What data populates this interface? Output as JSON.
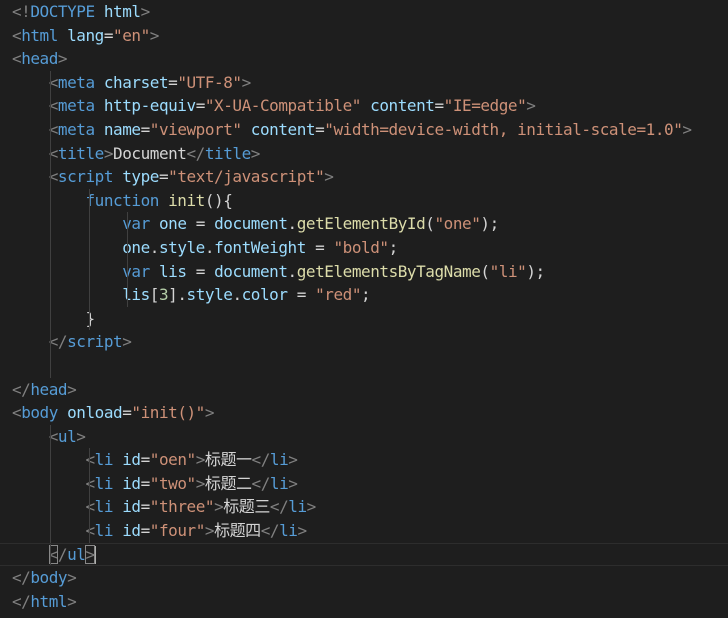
{
  "editor": {
    "colors": {
      "background": "#1e1e1e",
      "tag": "#569cd6",
      "attribute": "#9cdcfe",
      "string": "#ce9178",
      "function": "#dcdcaa",
      "punctuation": "#808080",
      "text": "#d4d4d4"
    },
    "lines": [
      {
        "indent": 0,
        "tokens": [
          [
            "punc",
            "<!"
          ],
          [
            "tag",
            "DOCTYPE"
          ],
          [
            "text",
            " "
          ],
          [
            "attr",
            "html"
          ],
          [
            "punc",
            ">"
          ]
        ]
      },
      {
        "indent": 0,
        "tokens": [
          [
            "punc",
            "<"
          ],
          [
            "tag",
            "html"
          ],
          [
            "text",
            " "
          ],
          [
            "attr",
            "lang"
          ],
          [
            "text",
            "="
          ],
          [
            "str",
            "\"en\""
          ],
          [
            "punc",
            ">"
          ]
        ]
      },
      {
        "indent": 0,
        "tokens": [
          [
            "punc",
            "<"
          ],
          [
            "tag",
            "head"
          ],
          [
            "punc",
            ">"
          ]
        ]
      },
      {
        "indent": 1,
        "tokens": [
          [
            "punc",
            "<"
          ],
          [
            "tag",
            "meta"
          ],
          [
            "text",
            " "
          ],
          [
            "attr",
            "charset"
          ],
          [
            "text",
            "="
          ],
          [
            "str",
            "\"UTF-8\""
          ],
          [
            "punc",
            ">"
          ]
        ]
      },
      {
        "indent": 1,
        "tokens": [
          [
            "punc",
            "<"
          ],
          [
            "tag",
            "meta"
          ],
          [
            "text",
            " "
          ],
          [
            "attr",
            "http-equiv"
          ],
          [
            "text",
            "="
          ],
          [
            "str",
            "\"X-UA-Compatible\""
          ],
          [
            "text",
            " "
          ],
          [
            "attr",
            "content"
          ],
          [
            "text",
            "="
          ],
          [
            "str",
            "\"IE=edge\""
          ],
          [
            "punc",
            ">"
          ]
        ]
      },
      {
        "indent": 1,
        "tokens": [
          [
            "punc",
            "<"
          ],
          [
            "tag",
            "meta"
          ],
          [
            "text",
            " "
          ],
          [
            "attr",
            "name"
          ],
          [
            "text",
            "="
          ],
          [
            "str",
            "\"viewport\""
          ],
          [
            "text",
            " "
          ],
          [
            "attr",
            "content"
          ],
          [
            "text",
            "="
          ],
          [
            "str",
            "\"width=device-width, initial-scale=1.0\""
          ],
          [
            "punc",
            ">"
          ]
        ]
      },
      {
        "indent": 1,
        "tokens": [
          [
            "punc",
            "<"
          ],
          [
            "tag",
            "title"
          ],
          [
            "punc",
            ">"
          ],
          [
            "text",
            "Document"
          ],
          [
            "punc",
            "</"
          ],
          [
            "tag",
            "title"
          ],
          [
            "punc",
            ">"
          ]
        ]
      },
      {
        "indent": 1,
        "tokens": [
          [
            "punc",
            "<"
          ],
          [
            "tag",
            "script"
          ],
          [
            "text",
            " "
          ],
          [
            "attr",
            "type"
          ],
          [
            "text",
            "="
          ],
          [
            "str",
            "\"text/javascript\""
          ],
          [
            "punc",
            ">"
          ]
        ]
      },
      {
        "indent": 2,
        "tokens": [
          [
            "kw",
            "function"
          ],
          [
            "text",
            " "
          ],
          [
            "fn",
            "init"
          ],
          [
            "text",
            "(){"
          ]
        ]
      },
      {
        "indent": 3,
        "tokens": [
          [
            "kw",
            "var"
          ],
          [
            "text",
            " "
          ],
          [
            "var",
            "one"
          ],
          [
            "text",
            " = "
          ],
          [
            "var",
            "document"
          ],
          [
            "text",
            "."
          ],
          [
            "fn",
            "getElementById"
          ],
          [
            "text",
            "("
          ],
          [
            "str",
            "\"one\""
          ],
          [
            "text",
            ");"
          ]
        ]
      },
      {
        "indent": 3,
        "tokens": [
          [
            "var",
            "one"
          ],
          [
            "text",
            "."
          ],
          [
            "var",
            "style"
          ],
          [
            "text",
            "."
          ],
          [
            "var",
            "fontWeight"
          ],
          [
            "text",
            " = "
          ],
          [
            "str",
            "\"bold\""
          ],
          [
            "text",
            ";"
          ]
        ]
      },
      {
        "indent": 3,
        "tokens": [
          [
            "kw",
            "var"
          ],
          [
            "text",
            " "
          ],
          [
            "var",
            "lis"
          ],
          [
            "text",
            " = "
          ],
          [
            "var",
            "document"
          ],
          [
            "text",
            "."
          ],
          [
            "fn",
            "getElementsByTagName"
          ],
          [
            "text",
            "("
          ],
          [
            "str",
            "\"li\""
          ],
          [
            "text",
            ");"
          ]
        ]
      },
      {
        "indent": 3,
        "tokens": [
          [
            "var",
            "lis"
          ],
          [
            "text",
            "["
          ],
          [
            "num",
            "3"
          ],
          [
            "text",
            "]."
          ],
          [
            "var",
            "style"
          ],
          [
            "text",
            "."
          ],
          [
            "var",
            "color"
          ],
          [
            "text",
            " = "
          ],
          [
            "str",
            "\"red\""
          ],
          [
            "text",
            ";"
          ]
        ]
      },
      {
        "indent": 2,
        "tokens": [
          [
            "text",
            "}"
          ]
        ]
      },
      {
        "indent": 1,
        "tokens": [
          [
            "punc",
            "</"
          ],
          [
            "tag",
            "script"
          ],
          [
            "punc",
            ">"
          ]
        ]
      },
      {
        "indent": 1,
        "tokens": []
      },
      {
        "indent": 0,
        "tokens": [
          [
            "punc",
            "</"
          ],
          [
            "tag",
            "head"
          ],
          [
            "punc",
            ">"
          ]
        ]
      },
      {
        "indent": 0,
        "tokens": [
          [
            "punc",
            "<"
          ],
          [
            "tag",
            "body"
          ],
          [
            "text",
            " "
          ],
          [
            "attr",
            "onload"
          ],
          [
            "text",
            "="
          ],
          [
            "str",
            "\"init()\""
          ],
          [
            "punc",
            ">"
          ]
        ]
      },
      {
        "indent": 1,
        "tokens": [
          [
            "punc",
            "<"
          ],
          [
            "tag",
            "ul"
          ],
          [
            "punc",
            ">"
          ]
        ]
      },
      {
        "indent": 2,
        "tokens": [
          [
            "punc",
            "<"
          ],
          [
            "tag",
            "li"
          ],
          [
            "text",
            " "
          ],
          [
            "attr",
            "id"
          ],
          [
            "text",
            "="
          ],
          [
            "str",
            "\"oen\""
          ],
          [
            "punc",
            ">"
          ],
          [
            "text",
            "标题一"
          ],
          [
            "punc",
            "</"
          ],
          [
            "tag",
            "li"
          ],
          [
            "punc",
            ">"
          ]
        ]
      },
      {
        "indent": 2,
        "tokens": [
          [
            "punc",
            "<"
          ],
          [
            "tag",
            "li"
          ],
          [
            "text",
            " "
          ],
          [
            "attr",
            "id"
          ],
          [
            "text",
            "="
          ],
          [
            "str",
            "\"two\""
          ],
          [
            "punc",
            ">"
          ],
          [
            "text",
            "标题二"
          ],
          [
            "punc",
            "</"
          ],
          [
            "tag",
            "li"
          ],
          [
            "punc",
            ">"
          ]
        ]
      },
      {
        "indent": 2,
        "tokens": [
          [
            "punc",
            "<"
          ],
          [
            "tag",
            "li"
          ],
          [
            "text",
            " "
          ],
          [
            "attr",
            "id"
          ],
          [
            "text",
            "="
          ],
          [
            "str",
            "\"three\""
          ],
          [
            "punc",
            ">"
          ],
          [
            "text",
            "标题三"
          ],
          [
            "punc",
            "</"
          ],
          [
            "tag",
            "li"
          ],
          [
            "punc",
            ">"
          ]
        ]
      },
      {
        "indent": 2,
        "tokens": [
          [
            "punc",
            "<"
          ],
          [
            "tag",
            "li"
          ],
          [
            "text",
            " "
          ],
          [
            "attr",
            "id"
          ],
          [
            "text",
            "="
          ],
          [
            "str",
            "\"four\""
          ],
          [
            "punc",
            ">"
          ],
          [
            "text",
            "标题四"
          ],
          [
            "punc",
            "</"
          ],
          [
            "tag",
            "li"
          ],
          [
            "punc",
            ">"
          ]
        ]
      },
      {
        "indent": 1,
        "current": true,
        "tokens": [
          [
            "punc",
            "<"
          ],
          [
            "punc",
            "/"
          ],
          [
            "tag",
            "ul"
          ],
          [
            "punc",
            ">"
          ]
        ]
      },
      {
        "indent": 0,
        "tokens": [
          [
            "punc",
            "</"
          ],
          [
            "tag",
            "body"
          ],
          [
            "punc",
            ">"
          ]
        ]
      },
      {
        "indent": 0,
        "tokens": [
          [
            "punc",
            "</"
          ],
          [
            "tag",
            "html"
          ],
          [
            "punc",
            ">"
          ]
        ]
      }
    ]
  }
}
